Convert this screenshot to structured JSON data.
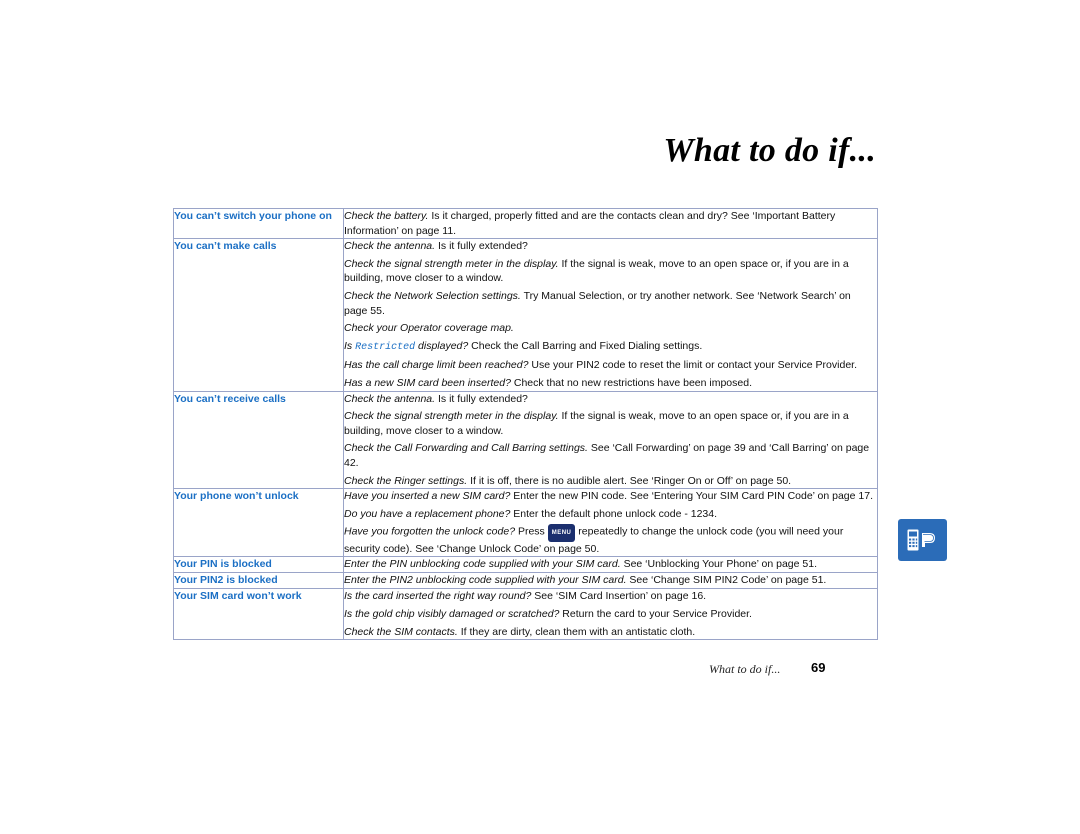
{
  "page": {
    "title": "What to do if...",
    "footer_text": "What to do if...",
    "folio": "69",
    "accent_blue": "#1b6fc4",
    "tab_icon_color": "#2b6cb8",
    "tab_icon_name": "phone-tab-icon"
  },
  "table": {
    "rows": [
      {
        "question": "You can’t switch your phone on",
        "answers": [
          {
            "em": "Check the battery.",
            "rest": " Is it charged, properly fitted and are the contacts clean and dry? See ‘Important Battery Information’ on page 11."
          }
        ]
      },
      {
        "question": "You can’t make calls",
        "answers": [
          {
            "em": "Check the antenna.",
            "rest": " Is it fully extended?"
          },
          {
            "em": "Check the signal strength meter in the display.",
            "rest": " If the signal is weak, move to an open space or, if you are in a building, move closer to a window."
          },
          {
            "em": "Check the Network Selection settings.",
            "rest": " Try Manual Selection, or try another network. See ‘Network Search’ on page 55."
          },
          {
            "em": "Check your Operator coverage map.",
            "rest": ""
          },
          {
            "em": "Is ",
            "mono": "Restricted",
            "em2": " displayed?",
            "rest": " Check the Call Barring and Fixed Dialing settings."
          },
          {
            "em": "Has the call charge limit been reached?",
            "rest": " Use your PIN2 code to reset the limit or contact your Service Provider."
          },
          {
            "em": "Has a new SIM card been inserted?",
            "rest": " Check that no new restrictions have been imposed."
          }
        ]
      },
      {
        "question": "You can’t receive calls",
        "answers": [
          {
            "em": "Check the antenna.",
            "rest": " Is it fully extended?"
          },
          {
            "em": "Check the signal strength meter in the display.",
            "rest": " If the signal is weak, move to an open space or, if you are in a building, move closer to a window."
          },
          {
            "em": "Check the Call Forwarding and Call Barring settings.",
            "rest": " See ‘Call Forwarding’ on page 39 and ‘Call Barring’ on page 42."
          },
          {
            "em": "Check the Ringer settings.",
            "rest": " If it is off, there is no audible alert. See ‘Ringer On or Off’ on page 50."
          }
        ]
      },
      {
        "question": "Your phone won’t unlock",
        "answers": [
          {
            "em": "Have you inserted a new SIM card?",
            "rest": " Enter the new PIN code. See ‘Entering Your SIM Card PIN Code’ on page 17."
          },
          {
            "em": "Do you have a replacement phone?",
            "rest": " Enter the default phone unlock code - 1234."
          },
          {
            "em": "Have you forgotten the unlock code?",
            "rest": " Press ",
            "key": "MENU",
            "rest2": " repeatedly to change the unlock code (you will need your security code). See ‘Change Unlock Code’ on page 50."
          }
        ]
      },
      {
        "question": "Your PIN is blocked",
        "answers": [
          {
            "em": "Enter the PIN unblocking code supplied with your SIM card.",
            "rest": " See ‘Unblocking Your Phone’ on page 51."
          }
        ]
      },
      {
        "question": "Your PIN2 is blocked",
        "answers": [
          {
            "em": "Enter the PIN2 unblocking code supplied with your SIM card.",
            "rest": " See ‘Change SIM PIN2 Code’ on page 51."
          }
        ]
      },
      {
        "question": "Your SIM card won’t work",
        "answers": [
          {
            "em": "Is the card inserted the right way round?",
            "rest": " See ‘SIM Card Insertion’ on page 16."
          },
          {
            "em": "Is the gold chip visibly damaged or scratched?",
            "rest": " Return the card to your Service Provider."
          },
          {
            "em": "Check the SIM contacts.",
            "rest": " If they are dirty, clean them with an antistatic cloth."
          }
        ]
      }
    ]
  }
}
